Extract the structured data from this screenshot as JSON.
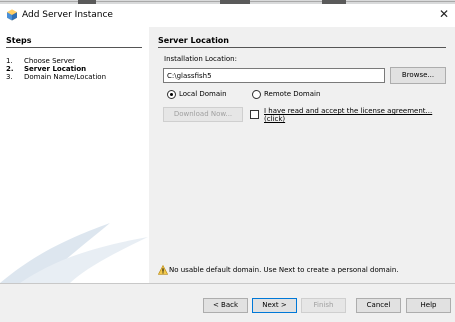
{
  "window": {
    "title": "Add Server Instance",
    "close_glyph": "✕",
    "icon": "glassfish-server-icon"
  },
  "steps": {
    "title": "Steps",
    "items": [
      {
        "num": "1.",
        "label": "Choose Server",
        "active": false
      },
      {
        "num": "2.",
        "label": "Server Location",
        "active": true
      },
      {
        "num": "3.",
        "label": "Domain Name/Location",
        "active": false
      }
    ]
  },
  "server_location": {
    "title": "Server Location",
    "install_label": "Installation Location:",
    "install_value": "C:\\glassfish5",
    "browse_label": "Browse...",
    "local_domain_label": "Local Domain",
    "local_domain_checked": true,
    "remote_domain_label": "Remote Domain",
    "remote_domain_checked": false,
    "download_label": "Download Now...",
    "license_checked": false,
    "license_text": "I have read and accept the license agreement... (click)",
    "notice_text": "No usable default domain. Use Next to create a personal domain."
  },
  "buttons": {
    "back": "< Back",
    "next": "Next >",
    "finish": "Finish",
    "cancel": "Cancel",
    "help": "Help"
  },
  "colors": {
    "accent": "#0078d7",
    "warning": "#f2c94c",
    "window_bg": "#f0f0f0"
  }
}
